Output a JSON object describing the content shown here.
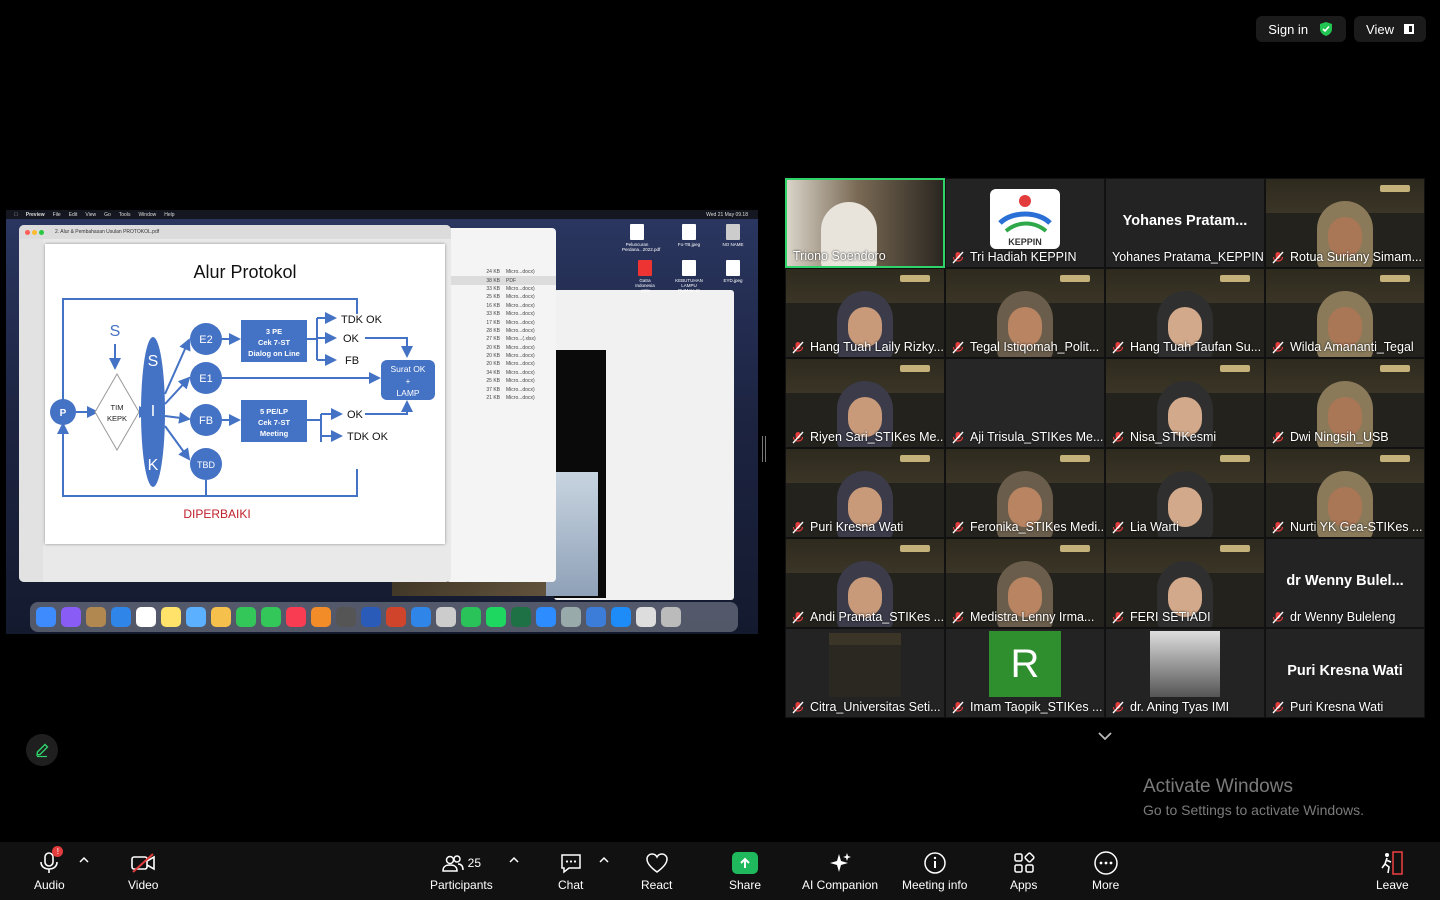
{
  "topbar": {
    "signin": "Sign in",
    "view": "View"
  },
  "colors": {
    "accent_green": "#2fd36a",
    "share_green": "#1fb85c",
    "mute_red": "#e23c3c",
    "toolbar_bg": "#111111"
  },
  "shared_screen": {
    "menubar": {
      "app": "Preview",
      "items": [
        "File",
        "Edit",
        "View",
        "Go",
        "Tools",
        "Window",
        "Help"
      ],
      "clock": "Wed 21 May 09.18"
    },
    "preview_title": "2. Alur & Pembahasan Usulan PROTOKOL.pdf",
    "slide": {
      "title": "Alur Protokol",
      "nodes": {
        "p": "P",
        "s": "S",
        "tim1": "TIM",
        "tim2": "KEPK",
        "sik_s": "S",
        "sik_i": "I",
        "sik_k": "K",
        "e2": "E2",
        "e1": "E1",
        "fb": "FB",
        "tbd": "TBD",
        "box1_l1": "3 PE",
        "box1_l2": "Cek 7-ST",
        "box1_l3": "Dialog on Line",
        "box2_l1": "5 PE/LP",
        "box2_l2": "Cek 7-ST",
        "box2_l3": "Meeting",
        "tdk_ok_1": "TDK OK",
        "ok_1": "OK",
        "fb_out": "FB",
        "ok_2": "OK",
        "tdk_ok_2": "TDK OK",
        "surat_l1": "Surat OK",
        "surat_l2": "+",
        "surat_l3": "LAMP",
        "diperbaiki": "DIPERBAIKI"
      }
    },
    "finder_rows": [
      {
        "size": "24 KB",
        "kind": "Micro...docx)"
      },
      {
        "size": "38 KB",
        "kind": "PDF"
      },
      {
        "size": "33 KB",
        "kind": "Micro...docx)"
      },
      {
        "size": "25 KB",
        "kind": "Micro...docx)"
      },
      {
        "size": "16 KB",
        "kind": "Micro...docx)"
      },
      {
        "size": "33 KB",
        "kind": "Micro...docx)"
      },
      {
        "size": "17 KB",
        "kind": "Micro...docx)"
      },
      {
        "size": "28 KB",
        "kind": "Micro...docx)"
      },
      {
        "size": "27 KB",
        "kind": "Micro...(.xlsx)"
      },
      {
        "size": "20 KB",
        "kind": "Micro...docx)"
      },
      {
        "size": "20 KB",
        "kind": "Micro...docx)"
      },
      {
        "size": "20 KB",
        "kind": "Micro...docx)"
      },
      {
        "size": "34 KB",
        "kind": "Micro...docx)"
      },
      {
        "size": "25 KB",
        "kind": "Micro...docx)"
      },
      {
        "size": "37 KB",
        "kind": "Micro...docx)"
      },
      {
        "size": "21 KB",
        "kind": "Micro...docx)"
      }
    ],
    "desktop_icons": [
      {
        "label": "Peluncuran Perdana...2022.pdf"
      },
      {
        "label": "Fo-TB.jpeg"
      },
      {
        "label": "NO NAME"
      },
      {
        "label": "Gatra Indonesia .pptx"
      },
      {
        "label": "KEBUTUHAN LAMPU RUMAH IS"
      },
      {
        "label": "EYD.jpeg"
      }
    ]
  },
  "participants": [
    {
      "name": "Triono Soendoro",
      "muted": false,
      "active": true,
      "type": "video"
    },
    {
      "name": "Tri Hadiah KEPPIN",
      "muted": true,
      "type": "logo"
    },
    {
      "name": "Yohanes Pratama_KEPPIN",
      "muted": false,
      "type": "name",
      "big": "Yohanes  Pratam..."
    },
    {
      "name": "Rotua Suriany Simam...",
      "muted": true,
      "type": "video"
    },
    {
      "name": "Hang Tuah Laily Rizky...",
      "muted": true,
      "type": "video"
    },
    {
      "name": "Tegal Istiqomah_Polit...",
      "muted": true,
      "type": "video"
    },
    {
      "name": "Hang Tuah Taufan Su...",
      "muted": true,
      "type": "video"
    },
    {
      "name": "Wilda Amananti_Tegal",
      "muted": true,
      "type": "video"
    },
    {
      "name": "Riyen Sari_STIKes Me...",
      "muted": true,
      "type": "video"
    },
    {
      "name": "Aji Trisula_STIKes Me...",
      "muted": true,
      "type": "blank"
    },
    {
      "name": "Nisa_STIKesmi",
      "muted": true,
      "type": "video"
    },
    {
      "name": "Dwi Ningsih_USB",
      "muted": true,
      "type": "video"
    },
    {
      "name": "Puri Kresna Wati",
      "muted": true,
      "type": "video"
    },
    {
      "name": "Feronika_STIKes Medi...",
      "muted": true,
      "type": "video"
    },
    {
      "name": "Lia Warti",
      "muted": true,
      "type": "video"
    },
    {
      "name": "Nurti YK Gea-STIKes ...",
      "muted": true,
      "type": "video"
    },
    {
      "name": "Andi Pranata_STIKes ...",
      "muted": true,
      "type": "video"
    },
    {
      "name": "Medistra Lenny Irma...",
      "muted": true,
      "type": "video"
    },
    {
      "name": "FERI SETIADI",
      "muted": true,
      "type": "video"
    },
    {
      "name": "dr Wenny Buleleng",
      "muted": true,
      "type": "name",
      "big": "dr  Wenny  Bulel..."
    },
    {
      "name": "Citra_Universitas Seti...",
      "muted": true,
      "type": "thumb"
    },
    {
      "name": "Imam Taopik_STIKes ...",
      "muted": true,
      "type": "letter",
      "letter": "R"
    },
    {
      "name": "dr. Aning Tyas IMI",
      "muted": true,
      "type": "photo"
    },
    {
      "name": "Puri Kresna Wati",
      "muted": true,
      "type": "name",
      "big": "Puri Kresna Wati"
    }
  ],
  "logo_text": "KEPPIN",
  "watermark": {
    "line1": "Activate Windows",
    "line2": "Go to Settings to activate Windows."
  },
  "toolbar": {
    "audio": "Audio",
    "audio_badge": "!",
    "video": "Video",
    "participants": "Participants",
    "participants_count": "25",
    "chat": "Chat",
    "react": "React",
    "share": "Share",
    "ai": "AI Companion",
    "info": "Meeting info",
    "apps": "Apps",
    "more": "More",
    "leave": "Leave"
  }
}
